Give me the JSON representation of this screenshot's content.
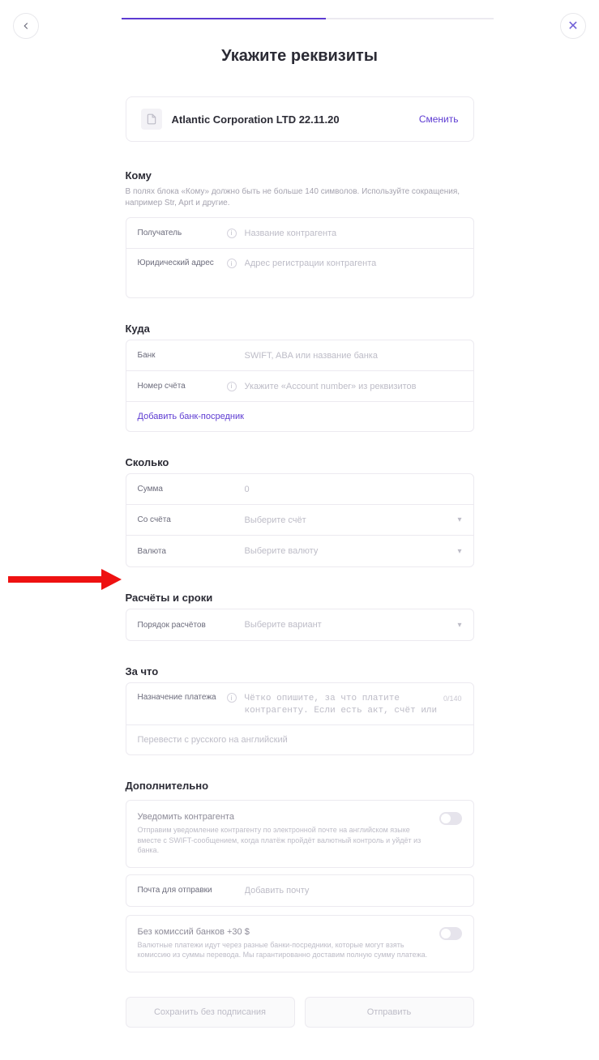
{
  "header": {
    "title": "Укажите реквизиты"
  },
  "company": {
    "name": "Atlantic Corporation LTD 22.11.20",
    "change_label": "Сменить"
  },
  "sections": {
    "kому": {
      "title": "Кому",
      "hint": "В полях блока «Кому» должно быть не больше 140 символов. Используйте сокращения, например Str, Aprt и другие.",
      "recipient_label": "Получатель",
      "recipient_placeholder": "Название контрагента",
      "legal_address_label": "Юридический адрес",
      "legal_address_placeholder": "Адрес регистрации контрагента"
    },
    "kуда": {
      "title": "Куда",
      "bank_label": "Банк",
      "bank_placeholder": "SWIFT, ABA или название банка",
      "account_label": "Номер счёта",
      "account_placeholder": "Укажите «Account number» из реквизитов",
      "add_intermediary": "Добавить банк-посредник"
    },
    "сколько": {
      "title": "Сколько",
      "amount_label": "Сумма",
      "amount_placeholder": "0",
      "from_account_label": "Со счёта",
      "from_account_placeholder": "Выберите счёт",
      "currency_label": "Валюта",
      "currency_placeholder": "Выберите валюту"
    },
    "расчёты": {
      "title": "Расчёты и сроки",
      "order_label": "Порядок расчётов",
      "order_placeholder": "Выберите вариант"
    },
    "зачто": {
      "title": "За что",
      "purpose_label": "Назначение платежа",
      "purpose_placeholder": "Чётко опишите, за что платите контрагенту. Если есть акт, счёт или договор, укажите его номер и дату.",
      "char_count": "0/140",
      "translate_link": "Перевести с русского на английский"
    },
    "дополнительно": {
      "title": "Дополнительно",
      "notify_title": "Уведомить контрагента",
      "notify_desc": "Отправим уведомление контрагенту по электронной почте на английском языке вместе с SWIFT-сообщением, когда платёж пройдёт валютный контроль и уйдёт из банка.",
      "email_label": "Почта для отправки",
      "email_placeholder": "Добавить почту",
      "fee_title": "Без комиссий банков +30 $",
      "fee_desc": "Валютные платежи идут через разные банки-посредники, которые могут взять комиссию из суммы перевода. Мы гарантированно доставим полную сумму платежа."
    }
  },
  "footer": {
    "save_label": "Сохранить без подписания",
    "send_label": "Отправить"
  }
}
